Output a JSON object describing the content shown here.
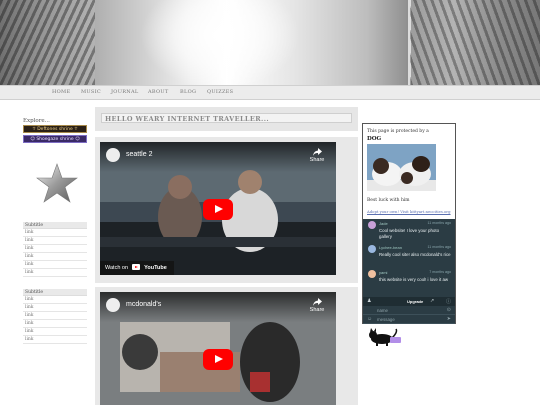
{
  "nav": {
    "items": [
      {
        "label": "HOME"
      },
      {
        "label": "MUSIC"
      },
      {
        "label": "JOURNAL"
      },
      {
        "label": "ABOUT"
      },
      {
        "label": "BLOG"
      },
      {
        "label": "QUIZZES"
      }
    ]
  },
  "sidebar": {
    "explore_label": "Explore...",
    "shrines": [
      {
        "label": "☥ Deftones shrine ☥",
        "icon": "ankh-icon"
      },
      {
        "label": "☺ Shoegaze shrine ☺",
        "icon": "smiley-icon"
      }
    ],
    "star_icon": "star-icon",
    "sections": [
      {
        "title": "Subtitle",
        "links": [
          "link",
          "link",
          "link",
          "link",
          "link",
          "link"
        ]
      },
      {
        "title": "Subtitle",
        "links": [
          "link",
          "link",
          "link",
          "link",
          "link",
          "link"
        ]
      }
    ]
  },
  "main": {
    "title": "HELLO WEARY INTERNET TRAVELLER...",
    "videos": [
      {
        "title": "seattle 2",
        "share_label": "Share",
        "watch_label": "Watch on",
        "brand": "YouTube"
      },
      {
        "title": "mcdonald's",
        "share_label": "Share"
      }
    ]
  },
  "widget": {
    "protected_text": "This page is protected by a",
    "dog_name": "DOG",
    "luck_text": "Best luck with him",
    "adopt_link": "Adopt your own! Visit kittyart.neocities.org",
    "chat": {
      "messages": [
        {
          "nick": "Jade",
          "time": "11 months ago",
          "text": "Cool website! I love your photo gallery",
          "avatar_color": "#c8a0d8"
        },
        {
          "nick": "Lychee-bean",
          "time": "11 months ago",
          "text": "Really cool site! also mcdonald's rice",
          "avatar_color": "#9ab8e0"
        },
        {
          "nick": "yami",
          "time": "7 months ago",
          "text": "this website is very cool! i love it aw",
          "avatar_color": "#f0c0a0"
        }
      ],
      "upgrade_label": "Upgrade",
      "name_placeholder": "name",
      "message_placeholder": "message"
    }
  },
  "colors": {
    "youtube_red": "#ff0000",
    "chat_bg": "#2b3c44",
    "shrine_purple": "#3a2a66"
  }
}
